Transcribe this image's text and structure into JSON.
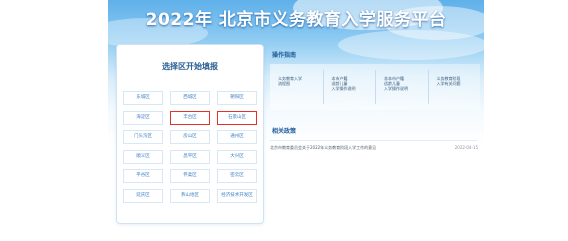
{
  "header": {
    "title": "2022年 北京市义务教育入学服务平台"
  },
  "district_panel": {
    "title": "选择区开始填报",
    "districts": [
      {
        "label": "东城区",
        "highlighted": false
      },
      {
        "label": "西城区",
        "highlighted": false
      },
      {
        "label": "朝阳区",
        "highlighted": false
      },
      {
        "label": "海淀区",
        "highlighted": false
      },
      {
        "label": "丰台区",
        "highlighted": true
      },
      {
        "label": "石景山区",
        "highlighted": true
      },
      {
        "label": "门头沟区",
        "highlighted": false
      },
      {
        "label": "房山区",
        "highlighted": false
      },
      {
        "label": "通州区",
        "highlighted": false
      },
      {
        "label": "顺义区",
        "highlighted": false
      },
      {
        "label": "昌平区",
        "highlighted": false
      },
      {
        "label": "大兴区",
        "highlighted": false
      },
      {
        "label": "平谷区",
        "highlighted": false
      },
      {
        "label": "怀柔区",
        "highlighted": false
      },
      {
        "label": "密云区",
        "highlighted": false
      },
      {
        "label": "延庆区",
        "highlighted": false
      },
      {
        "label": "燕山地区",
        "highlighted": false
      },
      {
        "label": "经济技术开发区",
        "highlighted": false
      }
    ],
    "highlight_color": "#e0322b"
  },
  "guide": {
    "title": "操作指南",
    "items": [
      {
        "line1": "义务教育入学",
        "line2": "流程图",
        "line3": ""
      },
      {
        "line1": "本市户籍",
        "line2": "适龄儿童",
        "line3": "入学操作说明"
      },
      {
        "line1": "非本市户籍",
        "line2": "适龄儿童",
        "line3": "入学操作说明"
      },
      {
        "line1": "义务教育阶段",
        "line2": "入学有关问题",
        "line3": ""
      }
    ]
  },
  "policy": {
    "title": "相关政策",
    "news": [
      {
        "title": "北京市教育委员会关于2022年义务教育阶段入学工作的意见",
        "date": "2022-04-15"
      }
    ]
  }
}
